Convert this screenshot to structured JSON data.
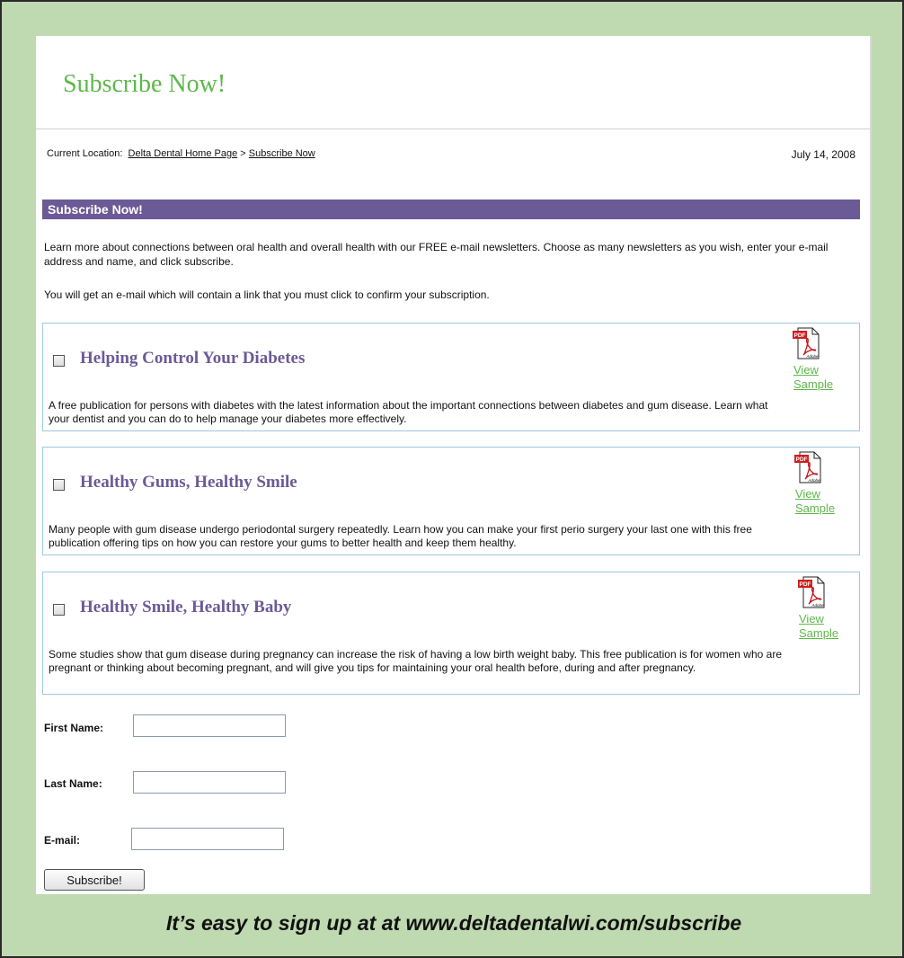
{
  "header": {
    "title": "Subscribe Now!"
  },
  "location": {
    "prefix": "Current Location:",
    "home_link": "Delta Dental Home Page",
    "separator": ">",
    "current_link": "Subscribe Now",
    "date": "July 14, 2008"
  },
  "section": {
    "title": "Subscribe Now!",
    "intro": "Learn more about connections between oral health and overall health with our FREE e-mail newsletters. Choose as many newsletters as you wish, enter your e-mail address and name, and click subscribe.",
    "intro2": "You will get an e-mail which will contain a link that you must click to confirm your subscription."
  },
  "publications": [
    {
      "title": "Helping Control Your Diabetes",
      "description": "A free publication for persons with diabetes with the latest information about the important connections between diabetes and gum disease. Learn what your dentist and you can do to help manage your diabetes more effectively.",
      "link_line1": "View",
      "link_line2": "Sample",
      "checked": false
    },
    {
      "title": "Healthy Gums, Healthy Smile",
      "description": "Many people with gum disease undergo periodontal surgery repeatedly. Learn how you can make your first perio surgery your last one with this free publication offering tips on how you can restore your gums to better health and keep them healthy.",
      "link_line1": "View",
      "link_line2": "Sample",
      "checked": false
    },
    {
      "title": "Healthy Smile, Healthy Baby",
      "description": "Some studies show that gum disease during pregnancy can increase the risk of having a low birth weight baby. This free publication is for women who are pregnant or thinking about becoming pregnant, and will give you tips for maintaining your oral health before, during and after pregnancy.",
      "link_line1": "View",
      "link_line2": "Sample",
      "checked": false
    }
  ],
  "pdf_icon": {
    "badge": "PDF",
    "brand": "Adobe"
  },
  "form": {
    "first_name_label": "First Name:",
    "first_name_value": "",
    "last_name_label": "Last Name:",
    "last_name_value": "",
    "email_label": "E-mail:",
    "email_value": "",
    "submit_label": "Subscribe!"
  },
  "caption": "It’s easy to sign up at at www.deltadentalwi.com/subscribe",
  "colors": {
    "frame_background": "#bfd9b0",
    "accent_purple": "#6b5a96",
    "link_green": "#5db84a",
    "box_border": "#9ec9df"
  }
}
